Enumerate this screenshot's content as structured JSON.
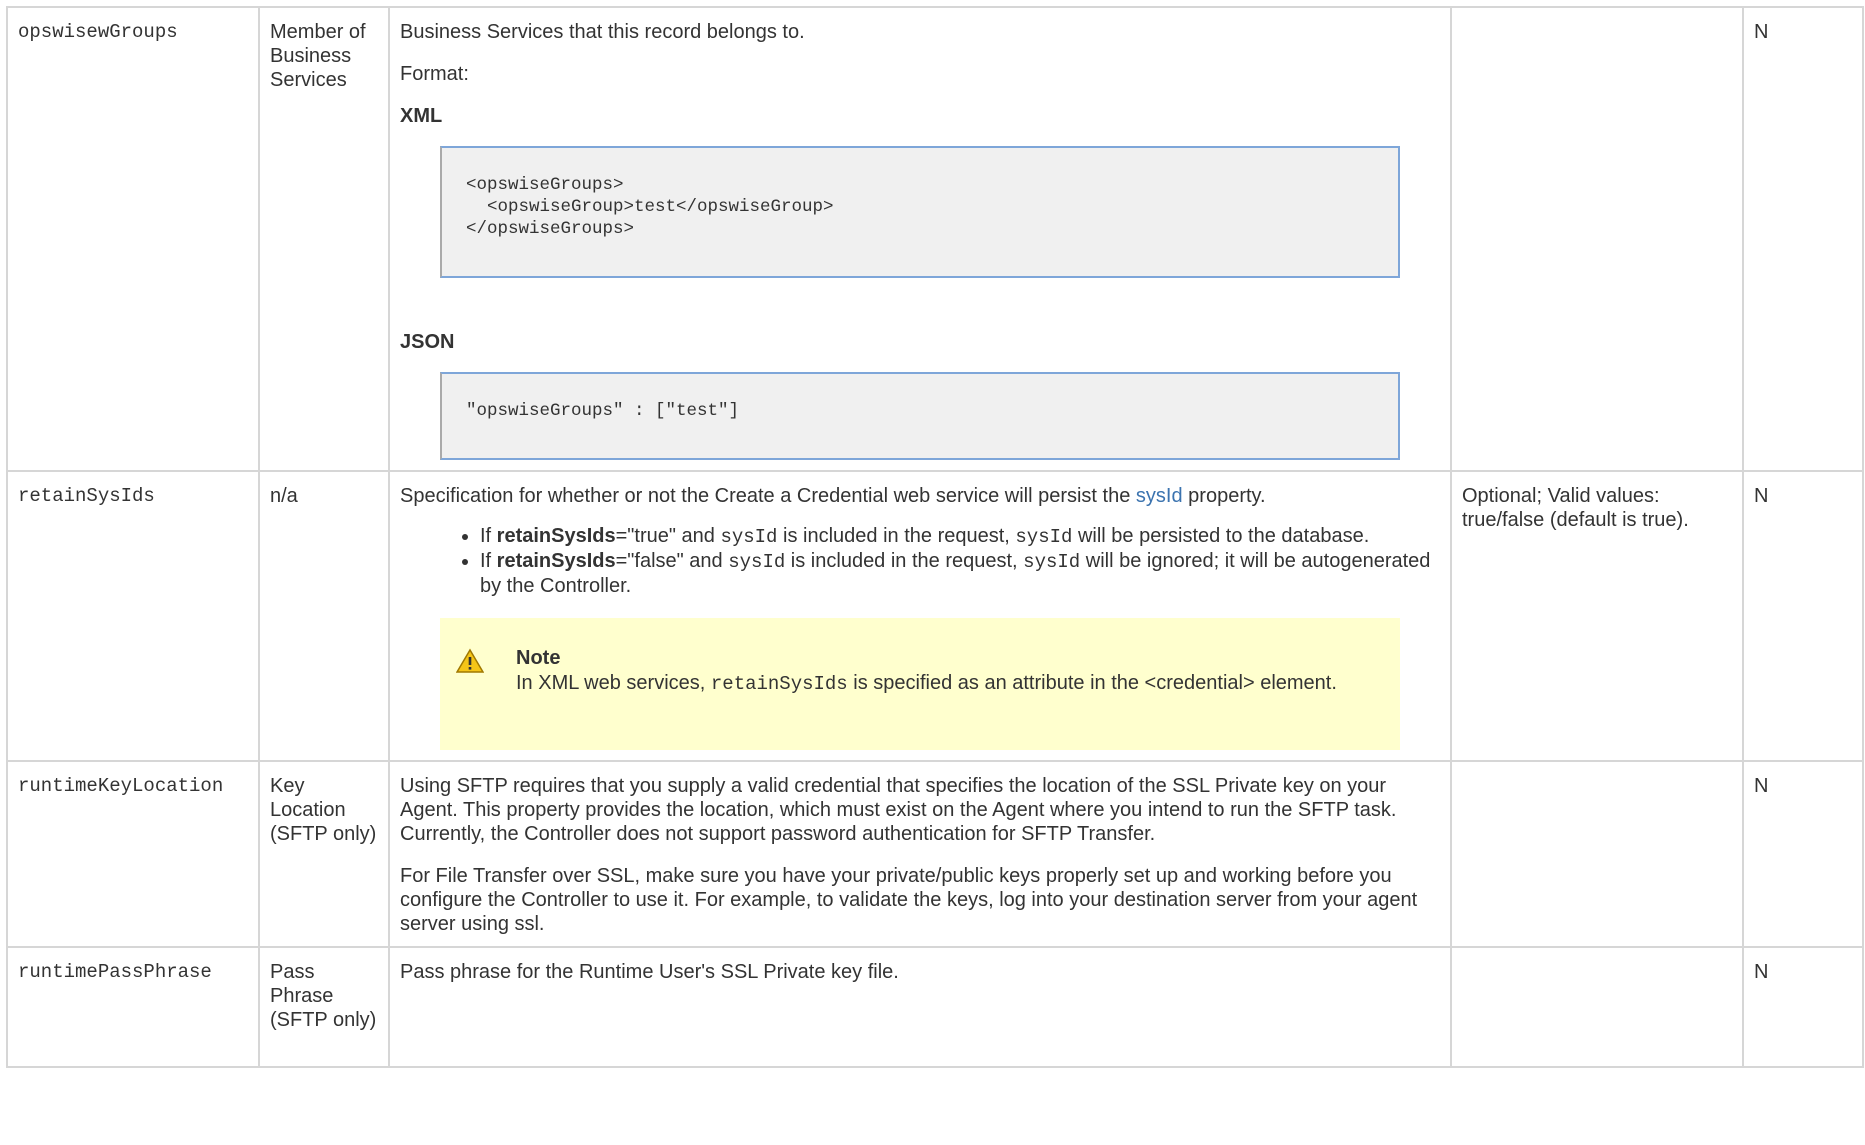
{
  "rows": [
    {
      "name": "opswisewGroups",
      "field": "Member of Business Services",
      "desc": "Business Services that this record belongs to.",
      "format_label": "Format:",
      "xml_label": "XML",
      "xml_code": "<opswiseGroups>\n  <opswiseGroup>test</opswiseGroup>\n</opswiseGroups>",
      "json_label": "JSON",
      "json_code": "\"opswiseGroups\" : [\"test\"]",
      "valid": "",
      "required": "N"
    },
    {
      "name": "retainSysIds",
      "field": "n/a",
      "desc_pre": "Specification for whether or not the Create a Credential web service will persist the ",
      "desc_link": "sysId",
      "desc_post": " property.",
      "bullet1": {
        "if": "If ",
        "key": "retainSysIds",
        "eq": "=\"true\" and ",
        "code1": "sysId",
        "mid": " is included in the request, ",
        "code2": "sysId",
        "end": " will be persisted to the database."
      },
      "bullet2": {
        "if": "If ",
        "key": "retainSysIds",
        "eq": "=\"false\" and ",
        "code1": "sysId",
        "mid": " is included in the request, ",
        "code2": "sysId",
        "end": " will be ignored; it will be autogenerated by the Controller."
      },
      "note_title": "Note",
      "note_pre": "In XML web services, ",
      "note_code": "retainSysIds",
      "note_post": " is specified as an attribute in the <credential> element.",
      "valid": "Optional; Valid values: true/false (default is true).",
      "required": "N"
    },
    {
      "name": "runtimeKeyLocation",
      "field": "Key Location (SFTP only)",
      "p1": "Using SFTP requires that you supply a valid credential that specifies the location of the SSL Private key on your Agent. This property provides the location, which must exist on the Agent where you intend to run the SFTP task. Currently, the Controller does not support password authentication for SFTP Transfer.",
      "p2": "For File Transfer over SSL, make sure you have your private/public keys properly set up and working before you configure the Controller to use it. For example, to validate the keys, log into your destination server from your agent server using ssl.",
      "valid": "",
      "required": "N"
    },
    {
      "name": "runtimePassPhrase",
      "field": "Pass Phrase (SFTP only)",
      "desc": "Pass phrase for the Runtime User's SSL Private key file.",
      "valid": "",
      "required": "N"
    }
  ],
  "icons": {
    "note": "warning-triangle-icon"
  },
  "colors": {
    "link": "#3b73af",
    "note_bg": "#ffffce",
    "code_bg": "#f0f0f0",
    "code_border": "#7ea6d9"
  }
}
